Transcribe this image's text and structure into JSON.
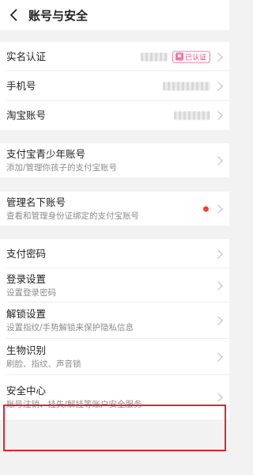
{
  "header": {
    "title": "账号与安全"
  },
  "accounts": {
    "real_name": {
      "label": "实名认证",
      "badge": "已认证"
    },
    "phone": {
      "label": "手机号"
    },
    "taobao": {
      "label": "淘宝账号"
    }
  },
  "teen": {
    "label": "支付宝青少年账号",
    "sub": "添加/管理你孩子的支付宝账号"
  },
  "manage": {
    "label": "管理名下账号",
    "sub": "查看和管理身份证绑定的支付宝账号"
  },
  "security": {
    "pay_password": {
      "label": "支付密码"
    },
    "login_settings": {
      "label": "登录设置",
      "sub": "设置登录密码"
    },
    "unlock_settings": {
      "label": "解锁设置",
      "sub": "设置指纹/手势解锁来保护隐私信息"
    },
    "biometrics": {
      "label": "生物识别",
      "sub": "刷脸、指纹、声音锁"
    },
    "security_center": {
      "label": "安全中心",
      "sub": "账号注销、挂失/解挂等账户安全服务"
    }
  },
  "colors": {
    "accent_badge": "#e2497d",
    "notice_dot": "#f5402d",
    "highlight": "#e8202b"
  }
}
